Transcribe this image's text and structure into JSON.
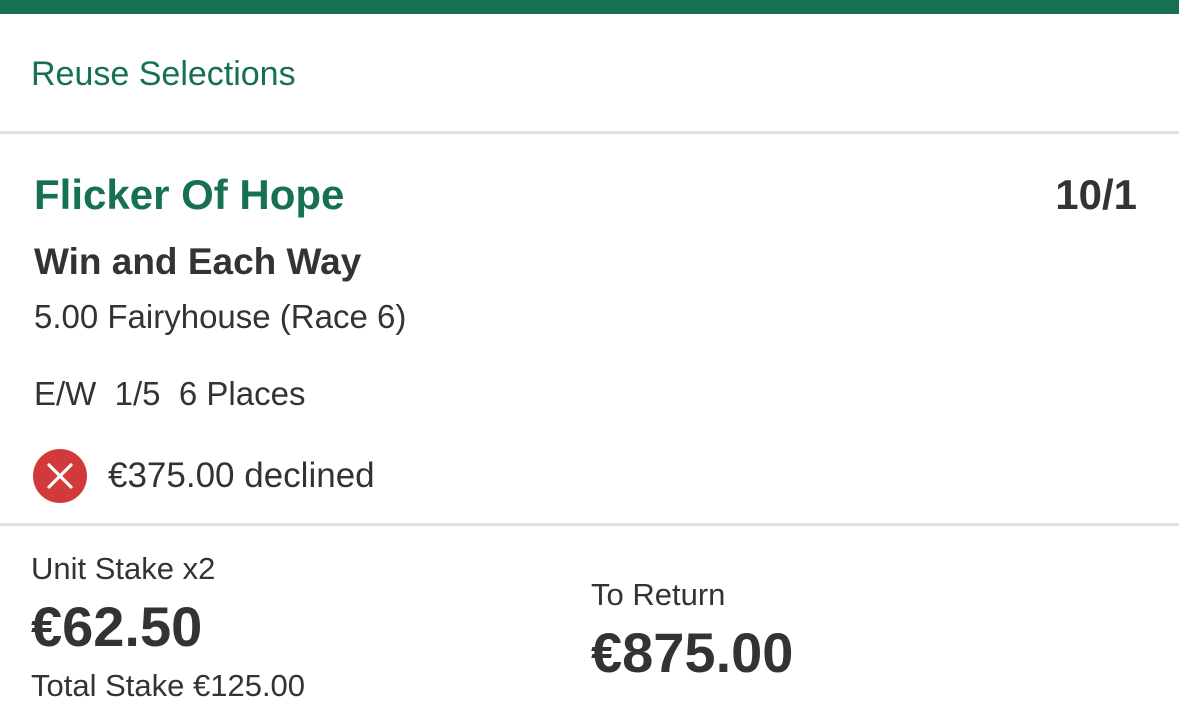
{
  "colors": {
    "brand_green": "#167052",
    "text_dark": "#333333",
    "divider": "#e2e2e2",
    "decline_red": "#d13a3a"
  },
  "header": {
    "reuse_label": "Reuse Selections"
  },
  "selection": {
    "name": "Flicker Of Hope",
    "odds": "10/1",
    "market": "Win and Each Way",
    "event": "5.00 Fairyhouse (Race 6)",
    "each_way_terms": "E/W  1/5  6 Places",
    "decline_icon": "close-x-icon",
    "decline_message": "€375.00 declined"
  },
  "stake": {
    "unit_label": "Unit Stake x2",
    "unit_value": "€62.50",
    "total_stake": "Total Stake €125.00"
  },
  "returns": {
    "label": "To Return",
    "value": "€875.00"
  }
}
